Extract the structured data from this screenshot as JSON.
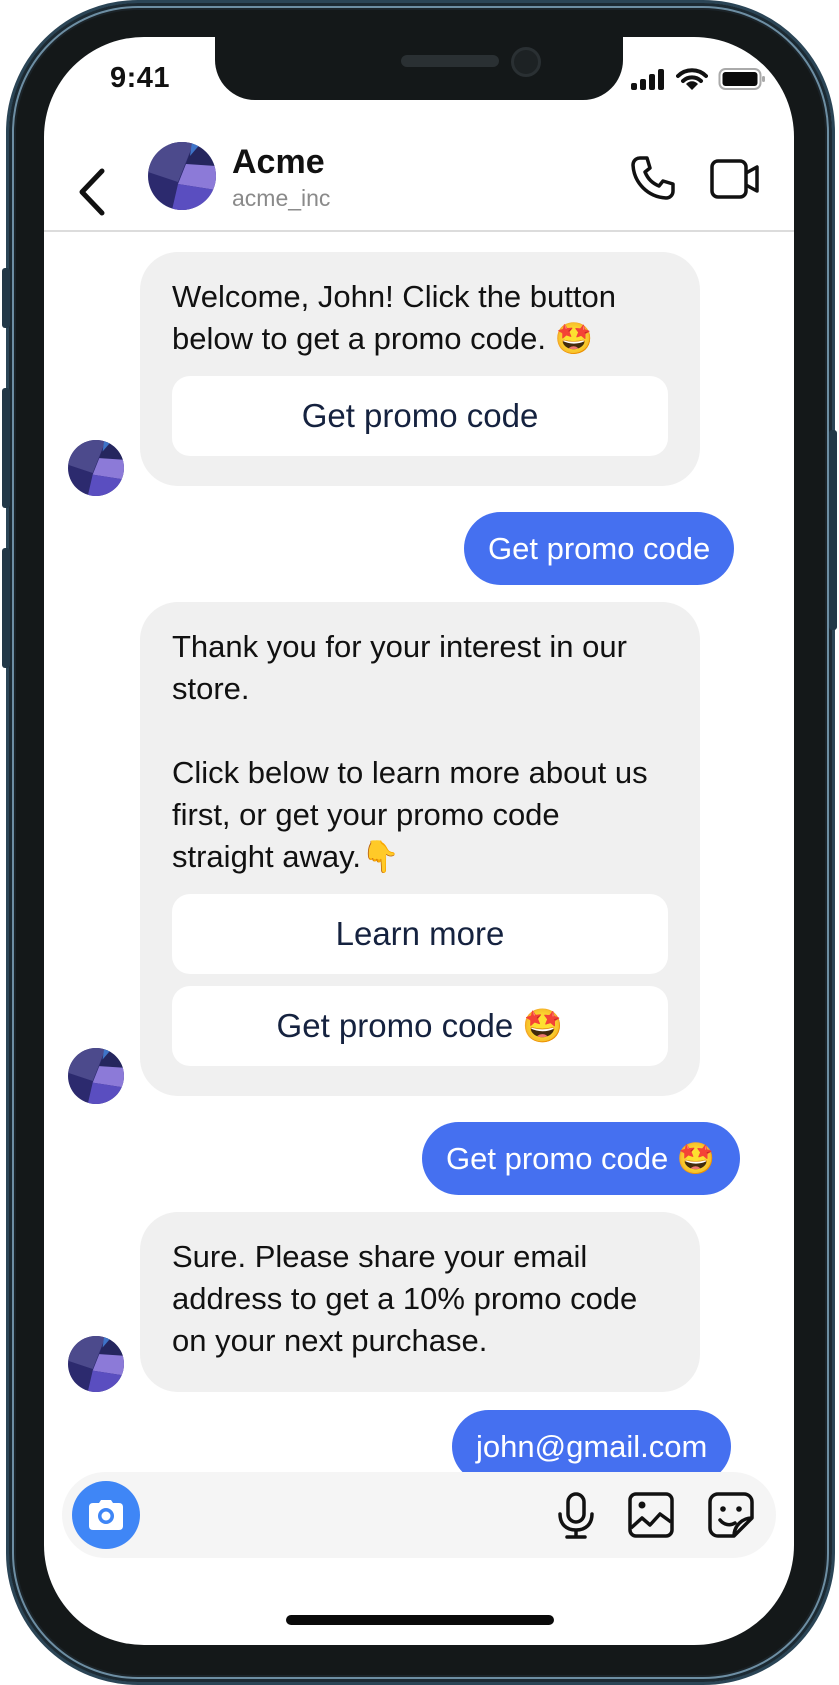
{
  "status_bar": {
    "time": "9:41",
    "icons": [
      "cellular-signal-icon",
      "wifi-icon",
      "battery-icon"
    ]
  },
  "header": {
    "back_icon": "chevron-left-icon",
    "contact_name": "Acme",
    "contact_handle": "acme_inc",
    "actions": [
      "phone-icon",
      "video-camera-icon"
    ]
  },
  "messages": [
    {
      "direction": "incoming",
      "text": "Welcome, John! Click the button below to get a promo code. 🤩",
      "buttons": [
        "Get promo code"
      ]
    },
    {
      "direction": "outgoing",
      "text": "Get promo code"
    },
    {
      "direction": "incoming",
      "text": "Thank you for your interest in our store.\n\nClick below to learn more about us first, or get your promo code straight away.👇",
      "buttons": [
        "Learn more",
        "Get promo code 🤩"
      ]
    },
    {
      "direction": "outgoing",
      "text": "Get promo code 🤩"
    },
    {
      "direction": "incoming",
      "text": "Sure. Please share your email address to get a 10% promo code on your next purchase."
    },
    {
      "direction": "outgoing",
      "text": "john@gmail.com"
    }
  ],
  "composer": {
    "left_icon": "camera-icon",
    "right_icons": [
      "microphone-icon",
      "image-icon",
      "sticker-icon"
    ]
  },
  "colors": {
    "outgoing_bubble": "#4570f0",
    "incoming_bubble": "#f0f0f0",
    "camera_button": "#3f86f6",
    "quick_reply_text": "#15223f",
    "frame": "#141819"
  }
}
